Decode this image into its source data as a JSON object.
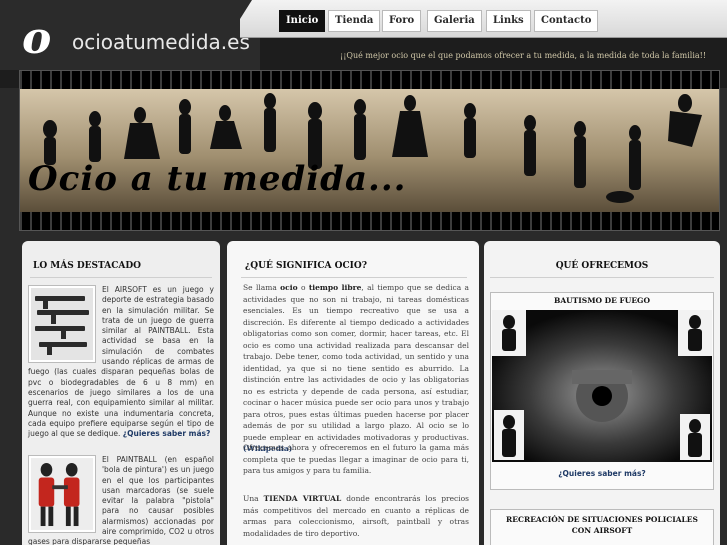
{
  "site": {
    "logo_letter": "o",
    "name": "ocioatumedida.es",
    "tagline": "¡¡Qué mejor ocio que el que podamos ofrecer a tu medida, a la medida de toda la familia!!"
  },
  "nav": {
    "items": [
      {
        "label": "Inicio",
        "active": true
      },
      {
        "label": "Tienda",
        "active": false
      },
      {
        "label": "Foro",
        "active": false
      },
      {
        "label": "Galeria",
        "active": false
      },
      {
        "label": "Links",
        "active": false
      },
      {
        "label": "Contacto",
        "active": false
      }
    ]
  },
  "banner": {
    "title": "Ocio a tu medida..."
  },
  "left": {
    "title": "LO MÁS DESTACADO",
    "items": [
      {
        "text": "El AIRSOFT es un juego y deporte de estrategia basado en la simulación militar. Se trata de un juego de guerra similar al PAINTBALL. Esta actividad se basa en la simulación de combates usando réplicas de armas de fuego (las cuales disparan pequeñas bolas de pvc o biodegradables de 6 u 8 mm) en escenarios de juego similares a los de una guerra real, con equipamiento similar al militar. Aunque no existe una indumentaria concreta, cada equipo prefiere equiparse según el tipo de juego al que se dedique.",
        "more": "¿Quieres saber más?"
      },
      {
        "text": "El PAINTBALL (en español 'bola de pintura') es un juego en el que los participantes usan marcadoras (se suele evitar la palabra \"pistola\" para no causar posibles alarmismos) accionadas por aire comprimido, CO2 u otros gases para dispararse pequeñas"
      }
    ]
  },
  "middle": {
    "title": "¿QUÉ SIGNIFICA OCIO?",
    "p1_a": "Se llama ",
    "p1_b": "ocio",
    "p1_c": " o ",
    "p1_d": "tiempo libre",
    "p1_e": ", al tiempo que se dedica a actividades que no son ni trabajo, ni tareas domésticas esenciales. Es un tiempo recreativo que se usa a discreción. Es diferente al tiempo dedicado a actividades obligatorias como son comer, dormir, hacer tareas, etc. El ocio es como una actividad realizada para descansar del trabajo. Debe tener, como toda actividad, un sentido y una identidad, ya que si no tiene sentido es aburrido. La distinción entre las actividades de ocio y las obligatorias no es estricta y depende de cada persona, así estudiar, cocinar o hacer música puede ser ocio para unos y trabajo para otros, pues estas últimas pueden hacerse por placer además de por su utilidad a largo plazo. Al ocio se lo puede emplear en actividades motivadoras y productivas. ",
    "wiki": "(Wikipedia)",
    "p2": "Ofrecemos ahora y ofreceremos en el futuro la gama más completa que te puedas llegar a imaginar de ocio para ti, para tus amigos y para tu familia.",
    "p3_a": "Una ",
    "p3_b": "TIENDA VIRTUAL",
    "p3_c": " donde encontrarás los precios más competitivos del mercado en cuanto a réplicas de armas para coleccionismo, airsoft, paintball y otras modalidades de tiro deportivo."
  },
  "right": {
    "title": "QUÉ OFRECEMOS",
    "box1_title": "BAUTISMO DE FUEGO",
    "box1_more": "¿Quieres saber más?",
    "box2_title": "RECREACIÓN DE SITUACIONES POLICIALES CON AIRSOFT"
  }
}
